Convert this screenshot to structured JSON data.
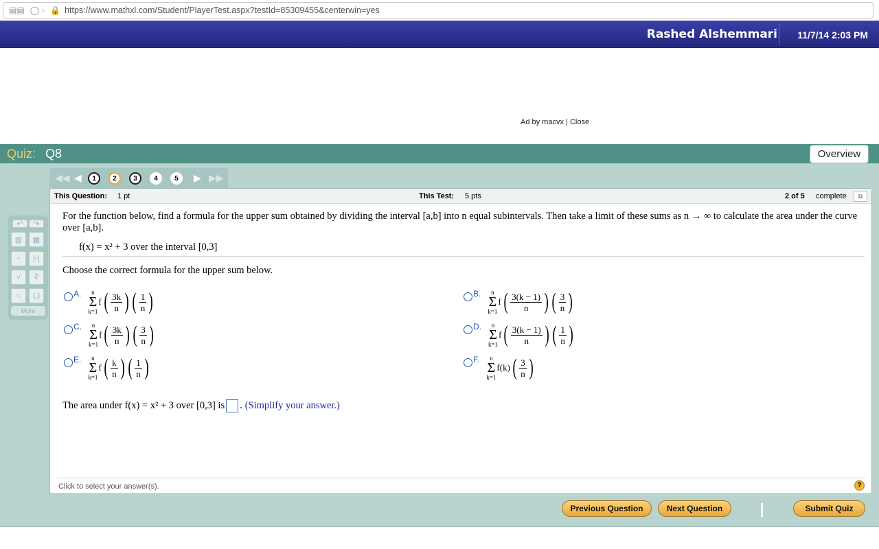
{
  "browser": {
    "url": "https://www.mathxl.com/Student/PlayerTest.aspx?testId=85309455&centerwin=yes"
  },
  "header": {
    "username": "Rashed Alshemmari",
    "datetime": "11/7/14 2:03 PM"
  },
  "ad": {
    "text": "Ad by macvx",
    "separator": "|",
    "close": "Close"
  },
  "quiz": {
    "label": "Quiz:",
    "name": "Q8",
    "overview": "Overview"
  },
  "tools": {
    "more": "More"
  },
  "nav": {
    "questions": [
      "1",
      "2",
      "3",
      "4",
      "5"
    ],
    "current": 2
  },
  "info": {
    "this_question_label": "This Question:",
    "this_question_value": "1 pt",
    "this_test_label": "This Test:",
    "this_test_value": "5 pts",
    "progress": "2 of 5",
    "complete": "complete"
  },
  "question": {
    "text": "For the function below, find a formula for the upper sum obtained by dividing the interval [a,b] into n equal subintervals. Then take a limit of these sums as n → ∞ to calculate the area under the curve over [a,b].",
    "function": "f(x) = x² + 3 over the interval [0,3]",
    "choose": "Choose the correct formula for the upper sum below.",
    "area_prefix": "The area under f(x) = x² + 3 over [0,3] is",
    "area_suffix": ".",
    "simplify": "(Simplify your answer.)"
  },
  "options": [
    {
      "letter": "A.",
      "upper": "n",
      "lower": "k=1",
      "arg_num": "3k",
      "arg_den": "n",
      "mult_num": "1",
      "mult_den": "n"
    },
    {
      "letter": "B.",
      "upper": "n",
      "lower": "k=1",
      "arg_num": "3(k − 1)",
      "arg_den": "n",
      "mult_num": "3",
      "mult_den": "n"
    },
    {
      "letter": "C.",
      "upper": "n",
      "lower": "k=1",
      "arg_num": "3k",
      "arg_den": "n",
      "mult_num": "3",
      "mult_den": "n"
    },
    {
      "letter": "D.",
      "upper": "n",
      "lower": "k=1",
      "arg_num": "3(k − 1)",
      "arg_den": "n",
      "mult_num": "1",
      "mult_den": "n"
    },
    {
      "letter": "E.",
      "upper": "n",
      "lower": "k=1",
      "arg_num": "k",
      "arg_den": "n",
      "mult_num": "1",
      "mult_den": "n"
    },
    {
      "letter": "F.",
      "upper": "n",
      "lower": "k=1",
      "fk": "f(k)",
      "mult_num": "3",
      "mult_den": "n"
    }
  ],
  "footer": {
    "hint": "Click to select your answer(s).",
    "help": "?",
    "prev": "Previous Question",
    "next": "Next Question",
    "submit": "Submit Quiz"
  }
}
